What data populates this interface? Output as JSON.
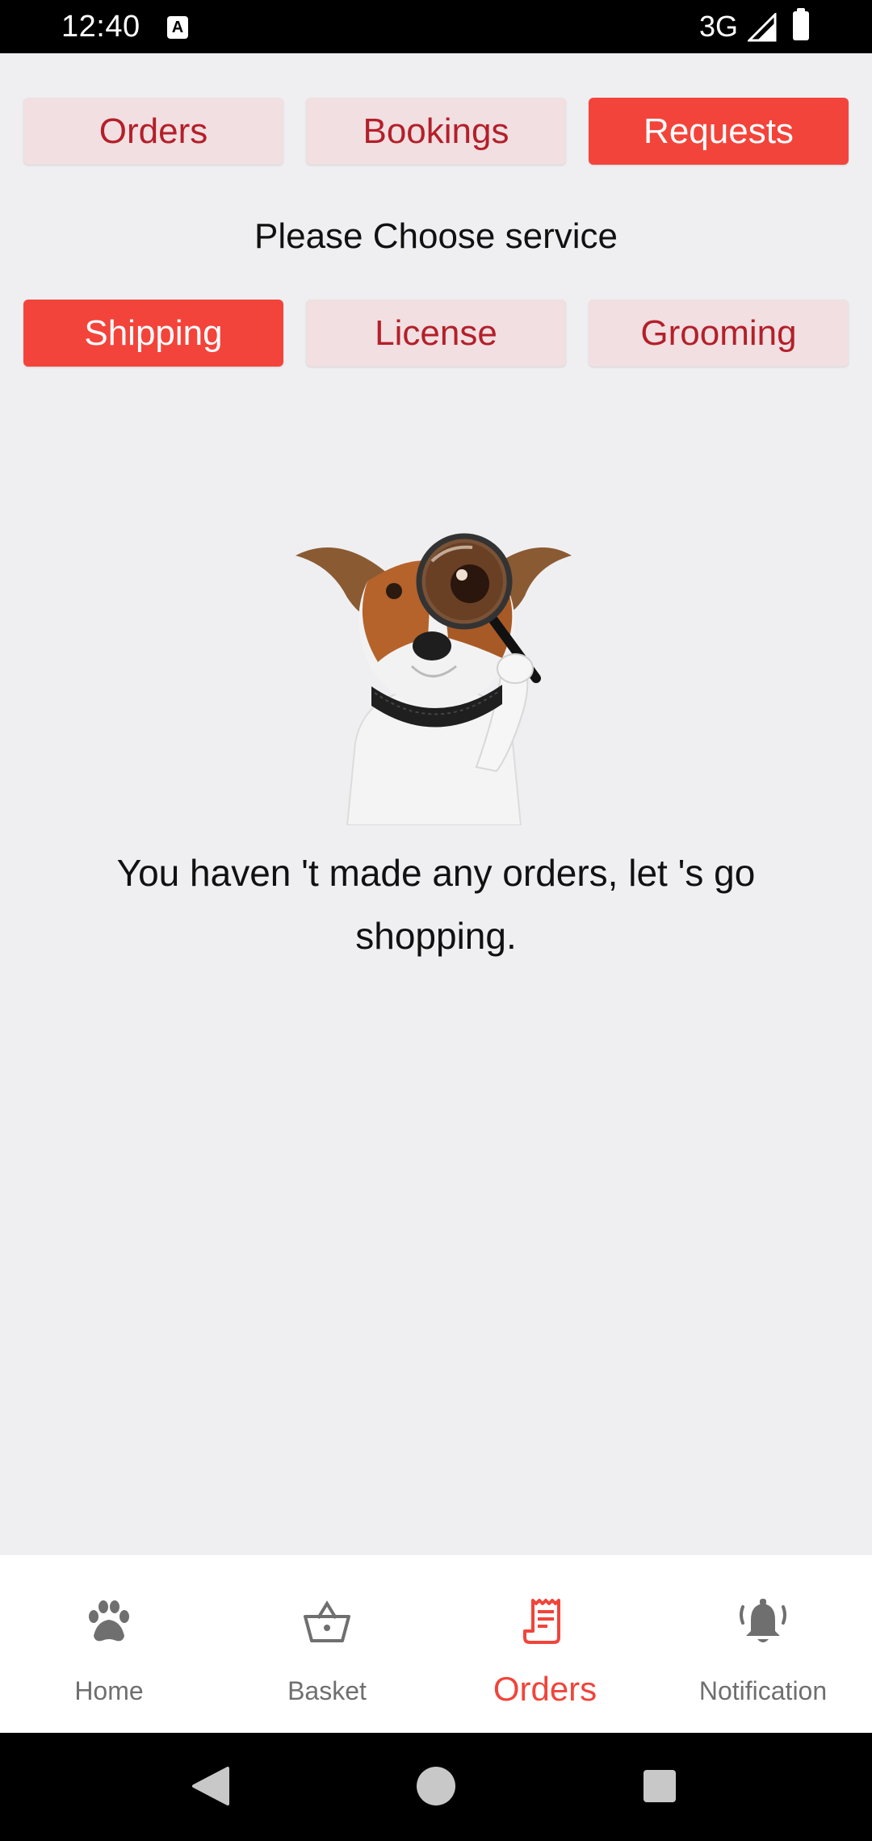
{
  "status_bar": {
    "time": "12:40",
    "a_icon_text": "A",
    "network": "3G",
    "icons": [
      "keyboard-a-icon",
      "signal-icon",
      "battery-icon"
    ]
  },
  "top_tabs": [
    {
      "label": "Orders",
      "active": false
    },
    {
      "label": "Bookings",
      "active": false
    },
    {
      "label": "Requests",
      "active": true
    }
  ],
  "service": {
    "prompt": "Please Choose service",
    "options": [
      {
        "label": "Shipping",
        "active": true
      },
      {
        "label": "License",
        "active": false
      },
      {
        "label": "Grooming",
        "active": false
      }
    ]
  },
  "empty_state": {
    "illustration": "dog-with-magnifying-glass",
    "message": "You haven 't made any orders, let 's go shopping."
  },
  "bottom_nav": [
    {
      "label": "Home",
      "icon": "paw-icon",
      "active": false
    },
    {
      "label": "Basket",
      "icon": "basket-icon",
      "active": false
    },
    {
      "label": "Orders",
      "icon": "receipt-icon",
      "active": true
    },
    {
      "label": "Notification",
      "icon": "bell-icon",
      "active": false
    }
  ],
  "colors": {
    "accent": "#f3443b",
    "inactive_button_bg": "#f1dfe1",
    "inactive_button_text": "#b3202a",
    "background": "#efeff1",
    "nav_inactive": "#6f6f6f"
  }
}
